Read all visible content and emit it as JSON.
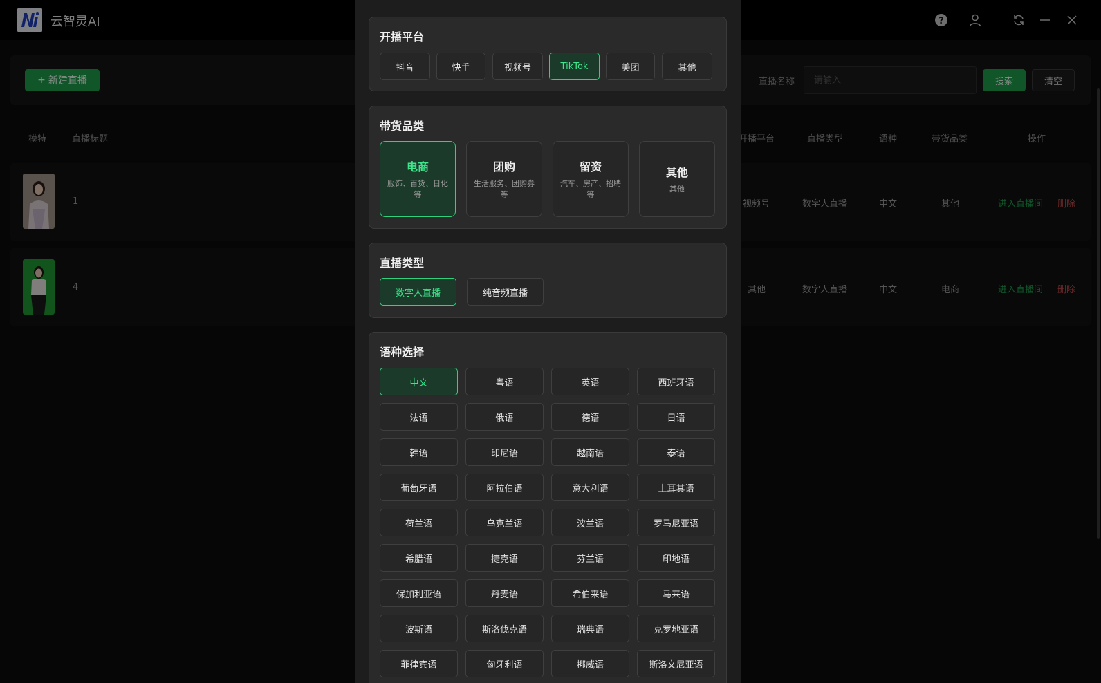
{
  "app": {
    "name": "云智灵AI"
  },
  "window_controls": [
    "help-icon",
    "user-icon",
    "refresh-icon",
    "minimize-icon",
    "close-icon"
  ],
  "toolbar": {
    "new_label": "新建直播",
    "search_label": "直播名称",
    "search_placeholder": "请输入",
    "search_button": "搜索",
    "clear_button": "清空"
  },
  "table": {
    "headers": {
      "model": "模特",
      "title": "直播标题",
      "platform": "开播平台",
      "type": "直播类型",
      "language": "语种",
      "category": "带货品类",
      "actions": "操作"
    },
    "rows": [
      {
        "title": "1",
        "platform": "视频号",
        "type": "数字人直播",
        "language": "中文",
        "category": "其他",
        "enter": "进入直播间",
        "delete": "删除"
      },
      {
        "title": "4",
        "platform": "其他",
        "type": "数字人直播",
        "language": "中文",
        "category": "电商",
        "enter": "进入直播间",
        "delete": "删除"
      }
    ]
  },
  "modal": {
    "platform": {
      "title": "开播平台",
      "options": [
        "抖音",
        "快手",
        "视频号",
        "TikTok",
        "美团",
        "其他"
      ],
      "selected": "TikTok"
    },
    "category": {
      "title": "带货品类",
      "options": [
        {
          "name": "电商",
          "desc": "服饰、百货、日化等"
        },
        {
          "name": "团购",
          "desc": "生活服务、团购券等"
        },
        {
          "name": "留资",
          "desc": "汽车、房产、招聘等"
        },
        {
          "name": "其他",
          "desc": "其他"
        }
      ],
      "selected": "电商"
    },
    "live_type": {
      "title": "直播类型",
      "options": [
        "数字人直播",
        "纯音频直播"
      ],
      "selected": "数字人直播"
    },
    "language": {
      "title": "语种选择",
      "options": [
        "中文",
        "粤语",
        "英语",
        "西班牙语",
        "法语",
        "俄语",
        "德语",
        "日语",
        "韩语",
        "印尼语",
        "越南语",
        "泰语",
        "葡萄牙语",
        "阿拉伯语",
        "意大利语",
        "土耳其语",
        "荷兰语",
        "乌克兰语",
        "波兰语",
        "罗马尼亚语",
        "希腊语",
        "捷克语",
        "芬兰语",
        "印地语",
        "保加利亚语",
        "丹麦语",
        "希伯来语",
        "马来语",
        "波斯语",
        "斯洛伐克语",
        "瑞典语",
        "克罗地亚语",
        "菲律宾语",
        "匈牙利语",
        "挪威语",
        "斯洛文尼亚语"
      ],
      "selected": "中文"
    }
  },
  "colors": {
    "accent": "#1f9d4c",
    "accent_text": "#3ee58c",
    "danger": "#c24a4a"
  }
}
